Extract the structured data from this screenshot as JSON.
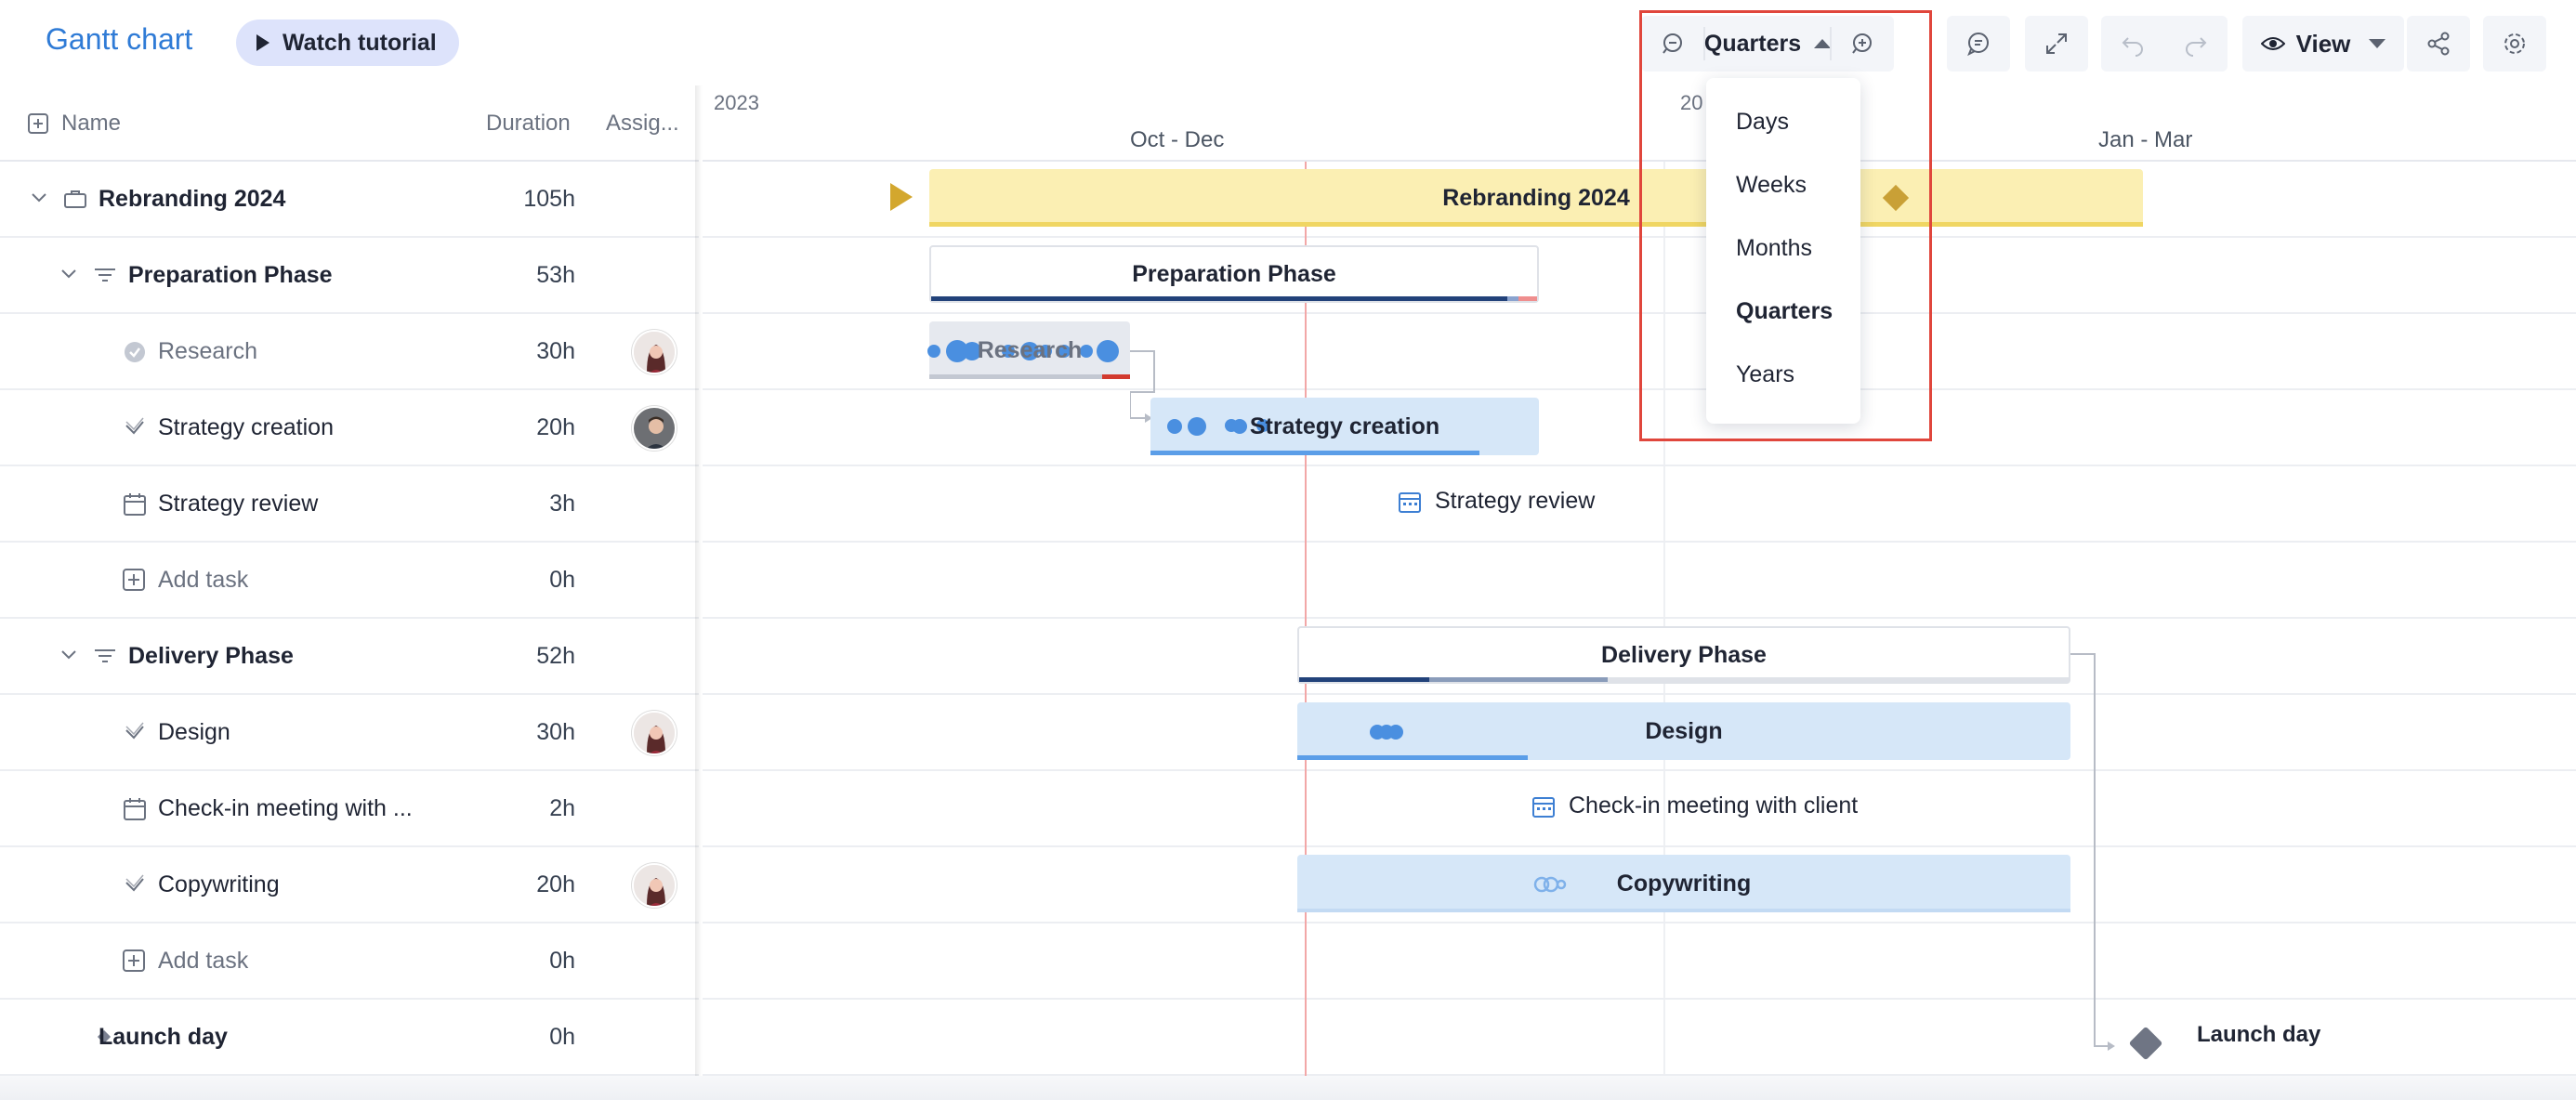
{
  "app": {
    "title": "Gantt chart",
    "tutorial_label": "Watch tutorial"
  },
  "toolbar": {
    "zoom_selected": "Quarters",
    "view_label": "View"
  },
  "zoom_menu": {
    "options": [
      "Days",
      "Weeks",
      "Months",
      "Quarters",
      "Years"
    ],
    "selected": "Quarters"
  },
  "grid": {
    "columns": {
      "name": "Name",
      "duration": "Duration",
      "assignee": "Assig..."
    },
    "rows": [
      {
        "name": "Rebranding 2024",
        "duration": "105h"
      },
      {
        "name": "Preparation Phase",
        "duration": "53h"
      },
      {
        "name": "Research",
        "duration": "30h"
      },
      {
        "name": "Strategy creation",
        "duration": "20h"
      },
      {
        "name": "Strategy review",
        "duration": "3h"
      },
      {
        "name": "Add task",
        "duration": "0h"
      },
      {
        "name": "Delivery Phase",
        "duration": "52h"
      },
      {
        "name": "Design",
        "duration": "30h"
      },
      {
        "name": "Check-in meeting with ...",
        "duration": "2h"
      },
      {
        "name": "Copywriting",
        "duration": "20h"
      },
      {
        "name": "Add task",
        "duration": "0h"
      },
      {
        "name": "Launch day",
        "duration": "0h"
      }
    ]
  },
  "timeline": {
    "year_left": "2023",
    "year_right": "20",
    "quarters": [
      "Oct - Dec",
      "Jan - Mar"
    ],
    "bars": {
      "rebranding": "Rebranding 2024",
      "preparation": "Preparation Phase",
      "research": "Research",
      "strategy_creation": "Strategy creation",
      "strategy_review": "Strategy review",
      "delivery": "Delivery Phase",
      "design": "Design",
      "checkin": "Check-in meeting with client",
      "copywriting": "Copywriting",
      "launch": "Launch day"
    }
  },
  "colors": {
    "accent": "#2f7bd6",
    "project_bar": "#fbefb3",
    "task_bar": "#d6e7f8",
    "highlight": "#e0463c",
    "today_line": "#f2a7a7"
  }
}
